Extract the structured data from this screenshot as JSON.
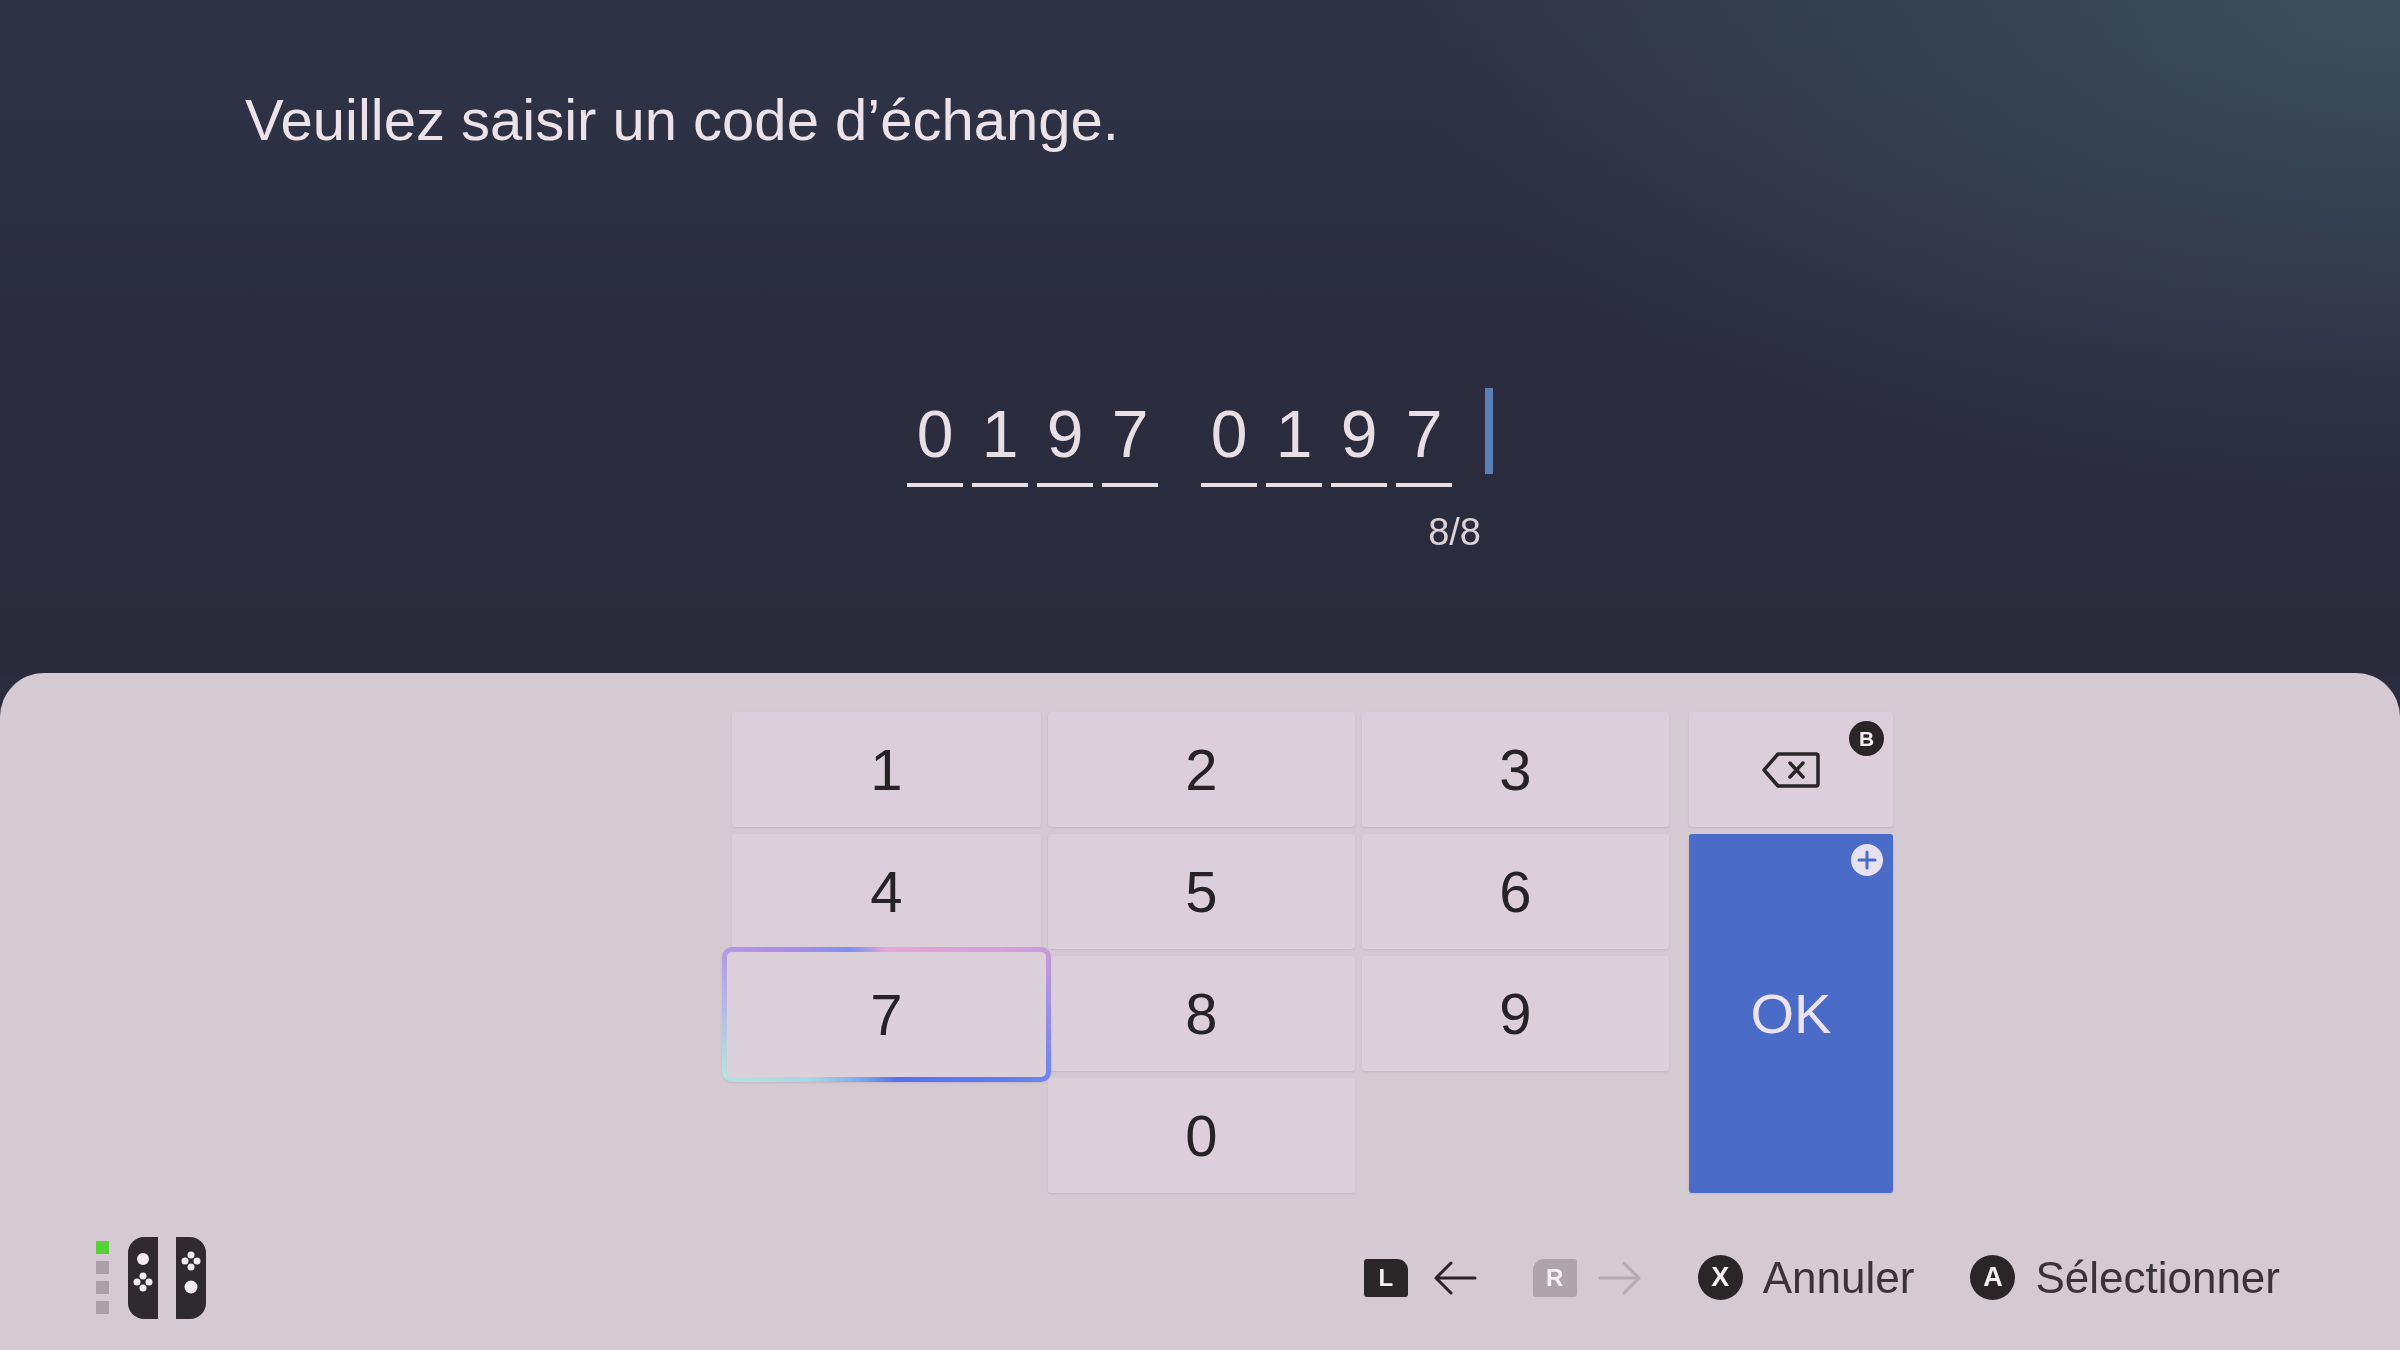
{
  "header": {
    "title": "Veuillez saisir un code d’échange."
  },
  "code_entry": {
    "groups": [
      [
        "0",
        "1",
        "9",
        "7"
      ],
      [
        "0",
        "1",
        "9",
        "7"
      ]
    ],
    "counter": "8/8"
  },
  "keypad": {
    "rows": [
      [
        {
          "label": "1",
          "selected": false
        },
        {
          "label": "2",
          "selected": false
        },
        {
          "label": "3",
          "selected": false
        }
      ],
      [
        {
          "label": "4",
          "selected": false
        },
        {
          "label": "5",
          "selected": false
        },
        {
          "label": "6",
          "selected": false
        }
      ],
      [
        {
          "label": "7",
          "selected": true
        },
        {
          "label": "8",
          "selected": false
        },
        {
          "label": "9",
          "selected": false
        }
      ],
      [
        "",
        {
          "label": "0",
          "selected": false
        }
      ]
    ],
    "backspace": {
      "hint": "B",
      "selected": false
    },
    "ok": {
      "label": "OK",
      "selected": false
    }
  },
  "controller": {
    "player_lights": [
      {
        "on": true
      },
      {
        "on": false
      },
      {
        "on": false
      },
      {
        "on": false
      }
    ]
  },
  "footer": {
    "hints": [
      {
        "kind": "prev",
        "key": "L",
        "disabled": false
      },
      {
        "kind": "next",
        "key": "R",
        "disabled": true
      },
      {
        "kind": "action",
        "key": "X",
        "label": "Annuler",
        "disabled": false
      },
      {
        "kind": "action",
        "key": "A",
        "label": "Sélectionner",
        "disabled": false
      }
    ]
  }
}
